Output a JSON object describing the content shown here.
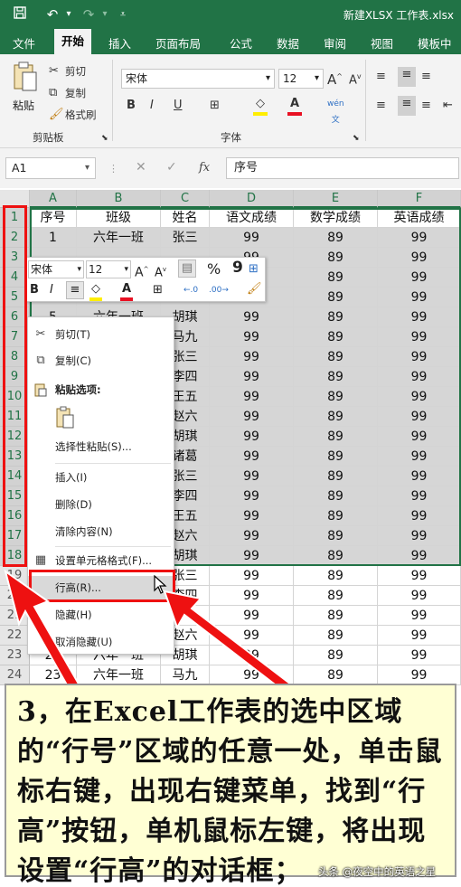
{
  "window": {
    "title": "新建XLSX 工作表.xlsx",
    "quick_access": {
      "save_icon": "save-icon",
      "undo_icon": "undo-icon",
      "redo_icon": "redo-icon",
      "customize_icon": "customize-icon"
    }
  },
  "ribbon_tabs": [
    "文件",
    "开始",
    "插入",
    "页面布局",
    "公式",
    "数据",
    "审阅",
    "视图",
    "模板中心"
  ],
  "ribbon": {
    "clipboard": {
      "paste": "粘贴",
      "cut": "剪切",
      "copy": "复制",
      "format_painter": "格式刷",
      "group_label": "剪贴板"
    },
    "font": {
      "font_name": "宋体",
      "font_size": "12",
      "group_label": "字体",
      "bold": "B",
      "italic": "I",
      "underline": "U"
    }
  },
  "formula_bar": {
    "cell_ref": "A1",
    "fx": "fx",
    "content": "序号"
  },
  "sheet": {
    "columns": [
      "A",
      "B",
      "C",
      "D",
      "E",
      "F"
    ],
    "header_row": [
      "序号",
      "班级",
      "姓名",
      "语文成绩",
      "数学成绩",
      "英语成绩"
    ],
    "rows": [
      {
        "num": "1",
        "cells": [
          "序号",
          "班级",
          "姓名",
          "语文成绩",
          "数学成绩",
          "英语成绩"
        ]
      },
      {
        "num": "2",
        "cells": [
          "1",
          "六年一班",
          "张三",
          "99",
          "89",
          "99"
        ]
      },
      {
        "num": "3",
        "cells": [
          "",
          "",
          "",
          "99",
          "89",
          "99"
        ]
      },
      {
        "num": "4",
        "cells": [
          "",
          "",
          "",
          "99",
          "89",
          "99"
        ]
      },
      {
        "num": "5",
        "cells": [
          "",
          "",
          "",
          "99",
          "89",
          "99"
        ]
      },
      {
        "num": "6",
        "cells": [
          "5",
          "六年一班",
          "胡琪",
          "99",
          "89",
          "99"
        ]
      },
      {
        "num": "7",
        "cells": [
          "",
          "",
          "马九",
          "99",
          "89",
          "99"
        ]
      },
      {
        "num": "8",
        "cells": [
          "",
          "",
          "张三",
          "99",
          "89",
          "99"
        ]
      },
      {
        "num": "9",
        "cells": [
          "",
          "",
          "李四",
          "99",
          "89",
          "99"
        ]
      },
      {
        "num": "10",
        "cells": [
          "",
          "",
          "王五",
          "99",
          "89",
          "99"
        ]
      },
      {
        "num": "11",
        "cells": [
          "",
          "",
          "赵六",
          "99",
          "89",
          "99"
        ]
      },
      {
        "num": "12",
        "cells": [
          "",
          "",
          "胡琪",
          "99",
          "89",
          "99"
        ]
      },
      {
        "num": "13",
        "cells": [
          "",
          "",
          "诸葛",
          "99",
          "89",
          "99"
        ]
      },
      {
        "num": "14",
        "cells": [
          "",
          "",
          "张三",
          "99",
          "89",
          "99"
        ]
      },
      {
        "num": "15",
        "cells": [
          "",
          "",
          "李四",
          "99",
          "89",
          "99"
        ]
      },
      {
        "num": "16",
        "cells": [
          "",
          "",
          "王五",
          "99",
          "89",
          "99"
        ]
      },
      {
        "num": "17",
        "cells": [
          "",
          "",
          "赵六",
          "99",
          "89",
          "99"
        ]
      },
      {
        "num": "18",
        "cells": [
          "",
          "",
          "胡琪",
          "99",
          "89",
          "99"
        ]
      },
      {
        "num": "19",
        "cells": [
          "",
          "",
          "张三",
          "99",
          "89",
          "99"
        ]
      },
      {
        "num": "20",
        "cells": [
          "",
          "",
          "李四",
          "99",
          "89",
          "99"
        ]
      },
      {
        "num": "21",
        "cells": [
          "",
          "",
          "",
          "99",
          "89",
          "99"
        ]
      },
      {
        "num": "22",
        "cells": [
          "",
          "",
          "赵六",
          "99",
          "89",
          "99"
        ]
      },
      {
        "num": "23",
        "cells": [
          "22",
          "六年一班",
          "胡琪",
          "99",
          "89",
          "99"
        ]
      },
      {
        "num": "24",
        "cells": [
          "23",
          "六年一班",
          "马九",
          "99",
          "89",
          "99"
        ]
      }
    ]
  },
  "mini_toolbar": {
    "font_name": "宋体",
    "font_size": "12",
    "percent": "%",
    "comma": "9",
    "bold": "B",
    "italic": "I"
  },
  "context_menu": {
    "items": [
      {
        "label": "剪切(T)",
        "icon": "cut-icon"
      },
      {
        "label": "复制(C)",
        "icon": "copy-icon"
      },
      {
        "label": "粘贴选项:",
        "icon": "paste-icon"
      },
      {
        "label": "选择性粘贴(S)...",
        "icon": ""
      },
      {
        "label": "插入(I)",
        "icon": ""
      },
      {
        "label": "删除(D)",
        "icon": ""
      },
      {
        "label": "清除内容(N)",
        "icon": ""
      },
      {
        "label": "设置单元格格式(F)...",
        "icon": "format-cells-icon"
      },
      {
        "label": "行高(R)...",
        "icon": ""
      },
      {
        "label": "隐藏(H)",
        "icon": ""
      },
      {
        "label": "取消隐藏(U)",
        "icon": ""
      }
    ]
  },
  "annotation": {
    "text": "3，在Excel工作表的选中区域的“行号”区域的任意一处，单击鼠标右键，出现右键菜单，找到“行高”按钮，单机鼠标左键，将出现设置“行高”的对话框；",
    "watermark": "头条 @夜空中的英语之星",
    "highlight_color": "#ee1111"
  }
}
